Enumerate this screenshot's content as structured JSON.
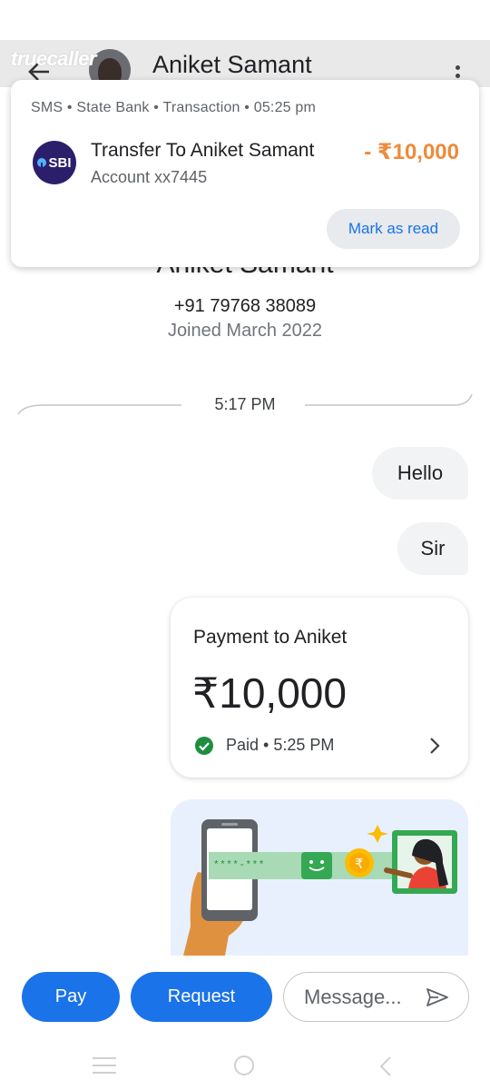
{
  "app": {
    "brand": "truecaller",
    "contact_name": "Aniket Samant"
  },
  "notification": {
    "meta": "SMS • State Bank • Transaction • 05:25 pm",
    "bank_logo_text": "SBI",
    "title": "Transfer To Aniket Samant",
    "amount": "- ₹10,000",
    "amount_color": "#ee8a3a",
    "account": "Account xx7445",
    "mark_read_label": "Mark as read"
  },
  "contact": {
    "name": "Aniket Samant",
    "phone": "+91 79768 38089",
    "joined": "Joined March 2022"
  },
  "chat": {
    "time_divider": "5:17 PM",
    "messages": [
      {
        "text": "Hello"
      },
      {
        "text": "Sir"
      }
    ],
    "payment": {
      "title": "Payment to Aniket",
      "amount": "₹10,000",
      "status": "Paid • 5:25 PM",
      "status_color": "#1e8e3e"
    },
    "promo": {
      "masked_number": "****-***"
    }
  },
  "composer": {
    "pay_label": "Pay",
    "request_label": "Request",
    "message_placeholder": "Message..."
  },
  "colors": {
    "primary": "#1a73e8",
    "bubble": "#f1f3f4"
  }
}
